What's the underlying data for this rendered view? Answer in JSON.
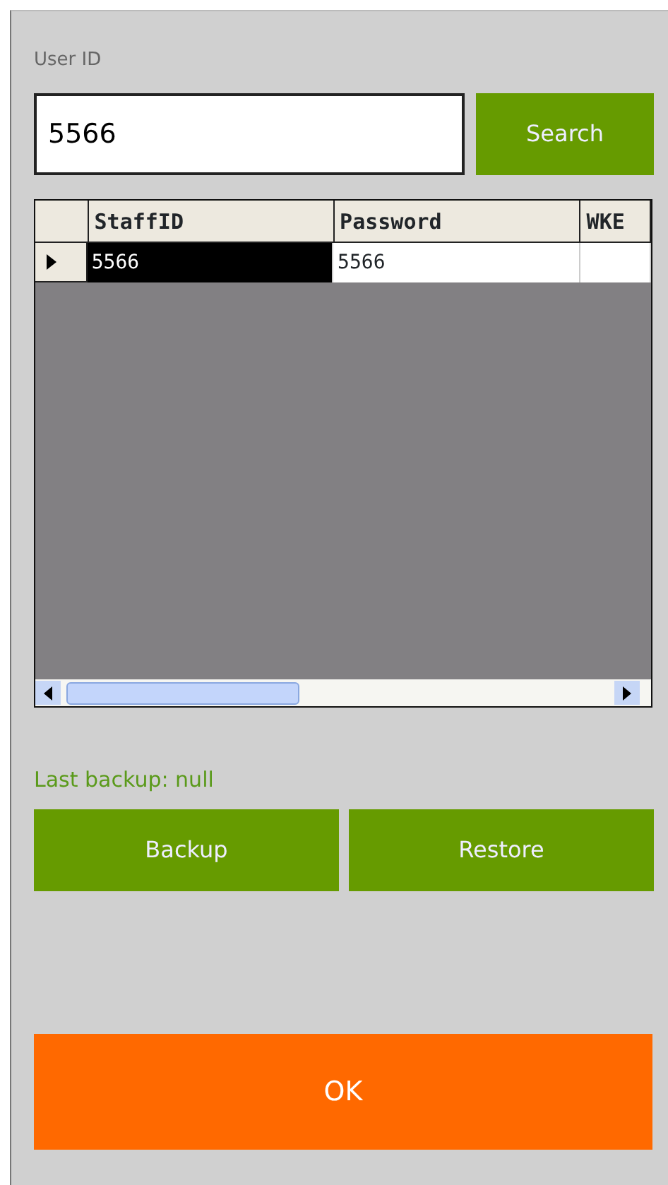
{
  "user_id": {
    "label": "User ID",
    "value": "5566"
  },
  "search_button": "Search",
  "grid": {
    "columns": [
      "StaffID",
      "Password",
      "WKE"
    ],
    "rows": [
      {
        "selected": true,
        "cells": [
          {
            "text": "5566",
            "selected": true
          },
          {
            "text": "5566",
            "selected": false
          }
        ]
      }
    ]
  },
  "last_backup": "Last backup: null",
  "buttons": [
    "Backup",
    "Restore"
  ],
  "ok_button": "OK"
}
